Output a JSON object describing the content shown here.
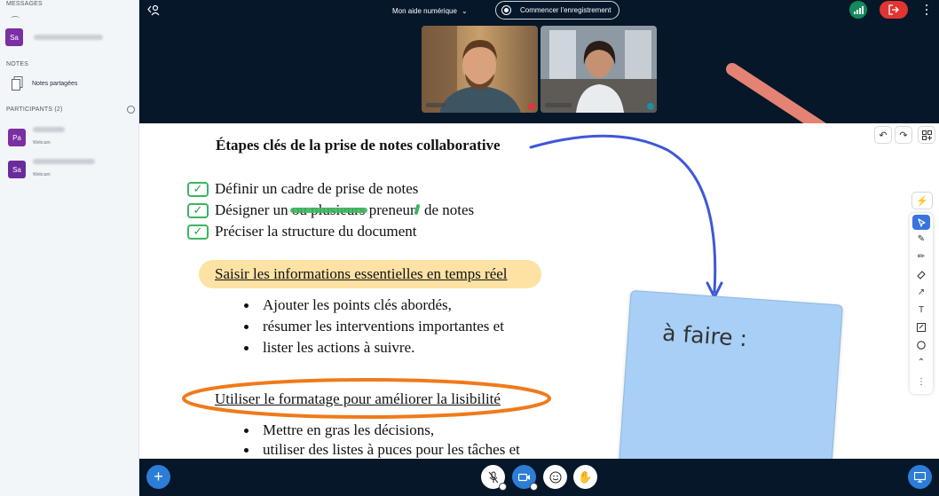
{
  "sidebar": {
    "messages_title": "MESSAGES",
    "chat_item": {
      "avatar": "Sa"
    },
    "notes_title": "NOTES",
    "shared_notes_label": "Notes partagées",
    "participants_title": "PARTICIPANTS (2)",
    "participants": [
      {
        "avatar": "Pa",
        "sub": "Webcam",
        "badge_color": "#e0353a"
      },
      {
        "avatar": "Sa",
        "sub": "Webcam",
        "badge_color": "#1e8ea8"
      }
    ]
  },
  "topbar": {
    "device_label": "Mon aide numérique",
    "record_label": "Commencer l'enregistrement"
  },
  "whiteboard": {
    "title": "Étapes clés de la prise de notes collaborative",
    "checklist": [
      {
        "text": "Définir un cadre de prise de notes"
      },
      {
        "prefix": "Désigner un ",
        "struck": "ou plusieurs",
        "middle": " preneur",
        "suffix": " de notes"
      },
      {
        "text": "Préciser la structure du document"
      }
    ],
    "section1": "Saisir les informations essentielles en temps réel",
    "bullets1": [
      "Ajouter les points clés abordés,",
      "résumer les interventions importantes et",
      "lister les actions à suivre."
    ],
    "section2": "Utiliser le formatage pour améliorer la lisibilité",
    "bullets2": [
      "Mettre en gras les décisions,",
      "utiliser des listes à puces pour les tâches et"
    ],
    "sticky_note": "à faire :"
  },
  "colors": {
    "highlight": "#fde2a4",
    "ellipse": "#f07a1a",
    "check": "#3cb55e",
    "arrow_blue": "#3f57d9",
    "sticky": "#a8cff5",
    "pointer_arrow": "#e48373"
  },
  "icons": {
    "toolbar": [
      "magic-icon",
      "select-icon",
      "pen-icon",
      "pencil-icon",
      "eraser-icon",
      "arrow-icon",
      "text-icon",
      "note-icon",
      "shape-icon",
      "collapse-icon",
      "more-icon"
    ]
  }
}
